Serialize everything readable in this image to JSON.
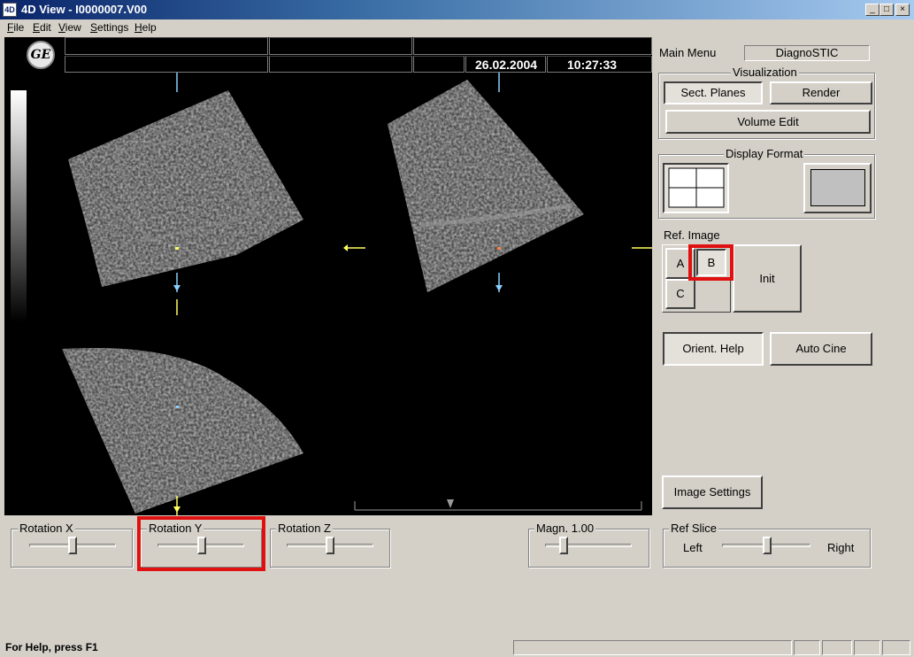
{
  "window": {
    "title": "4D View - I0000007.V00",
    "app_icon": "4D",
    "minimize": "_",
    "maximize": "□",
    "close": "×"
  },
  "menu": [
    "File",
    "Edit",
    "View",
    "Settings",
    "Help"
  ],
  "viewport": {
    "logo": "GE",
    "date": "26.02.2004",
    "time": "10:27:33"
  },
  "right_panel": {
    "main_menu_label": "Main Menu",
    "mode_value": "DiagnoSTIC",
    "visualization": {
      "title": "Visualization",
      "sect_planes": "Sect. Planes",
      "render": "Render",
      "volume_edit": "Volume Edit"
    },
    "display_format": {
      "title": "Display Format"
    },
    "ref_image": {
      "title": "Ref. Image",
      "a": "A",
      "b": "B",
      "c": "C",
      "init": "Init"
    },
    "orient_help": "Orient. Help",
    "auto_cine": "Auto Cine",
    "image_settings": "Image Settings"
  },
  "controls": {
    "rotation_x": "Rotation X",
    "rotation_y": "Rotation Y",
    "rotation_z": "Rotation Z",
    "magn": "Magn. 1.00",
    "ref_slice": "Ref Slice",
    "left": "Left",
    "right": "Right"
  },
  "status": {
    "help_text": "For Help, press F1"
  },
  "colors": {
    "title_start": "#0a246a",
    "title_end": "#a6caf0",
    "highlight": "#e01010",
    "marker_yellow": "#ffff60",
    "marker_blue": "#8ad0ff"
  }
}
